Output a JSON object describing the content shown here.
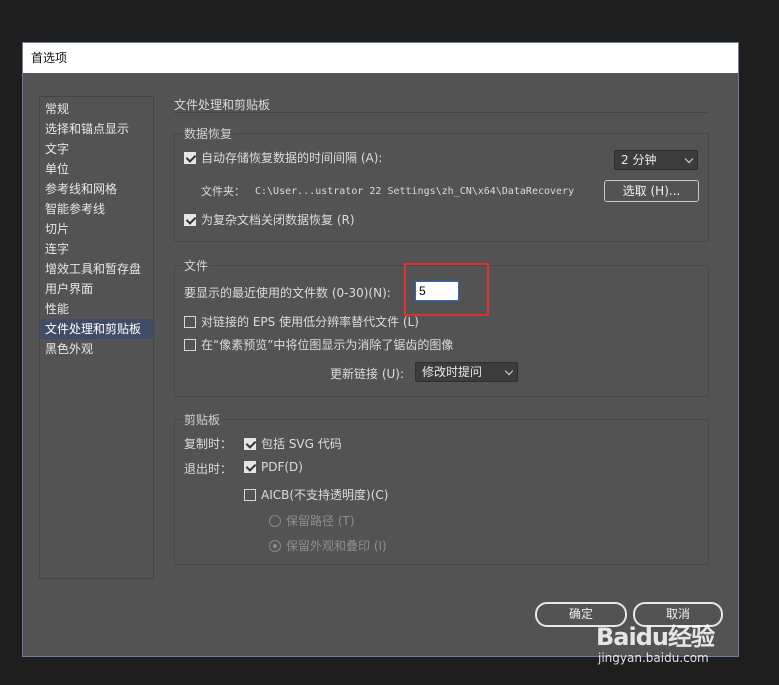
{
  "dialog": {
    "title": "首选项",
    "sidebar": {
      "items": [
        "常规",
        "选择和锚点显示",
        "文字",
        "单位",
        "参考线和网格",
        "智能参考线",
        "切片",
        "连字",
        "增效工具和暂存盘",
        "用户界面",
        "性能",
        "文件处理和剪贴板",
        "黑色外观"
      ],
      "selected_index": 11
    },
    "section_title": "文件处理和剪贴板",
    "data_recovery": {
      "title": "数据恢复",
      "autosave_label": "自动存储恢复数据的时间间隔 (A):",
      "autosave_checked": true,
      "interval_value": "2 分钟",
      "folder_label": "文件夹：",
      "folder_path": "C:\\User...ustrator 22 Settings\\zh_CN\\x64\\DataRecovery",
      "choose_button": "选取 (H)...",
      "complex_label": "为复杂文档关闭数据恢复 (R)",
      "complex_checked": true
    },
    "files": {
      "title": "文件",
      "recent_label": "要显示的最近使用的文件数 (0-30)(N):",
      "recent_value": "5",
      "eps_label": "对链接的 EPS 使用低分辨率替代文件 (L)",
      "eps_checked": false,
      "pixel_label": "在“像素预览”中将位图显示为消除了锯齿的图像",
      "pixel_checked": false,
      "update_label": "更新链接 (U):",
      "update_value": "修改时提问"
    },
    "clipboard": {
      "title": "剪贴板",
      "copy_label": "复制时：",
      "svg_label": "包括 SVG 代码",
      "svg_checked": true,
      "quit_label": "退出时：",
      "pdf_label": "PDF(D)",
      "pdf_checked": true,
      "aicb_label": "AICB(不支持透明度)(C)",
      "aicb_checked": false,
      "keep_path_label": "保留路径 (T)",
      "keep_appearance_label": "保留外观和叠印 (I)"
    },
    "ok_button": "确定",
    "cancel_button": "取消"
  },
  "watermark": {
    "logo": "Baidu经验",
    "url": "jingyan.baidu.com"
  },
  "colors": {
    "panel": "#535353",
    "selection": "#3f4d66",
    "highlight": "#e03030"
  }
}
